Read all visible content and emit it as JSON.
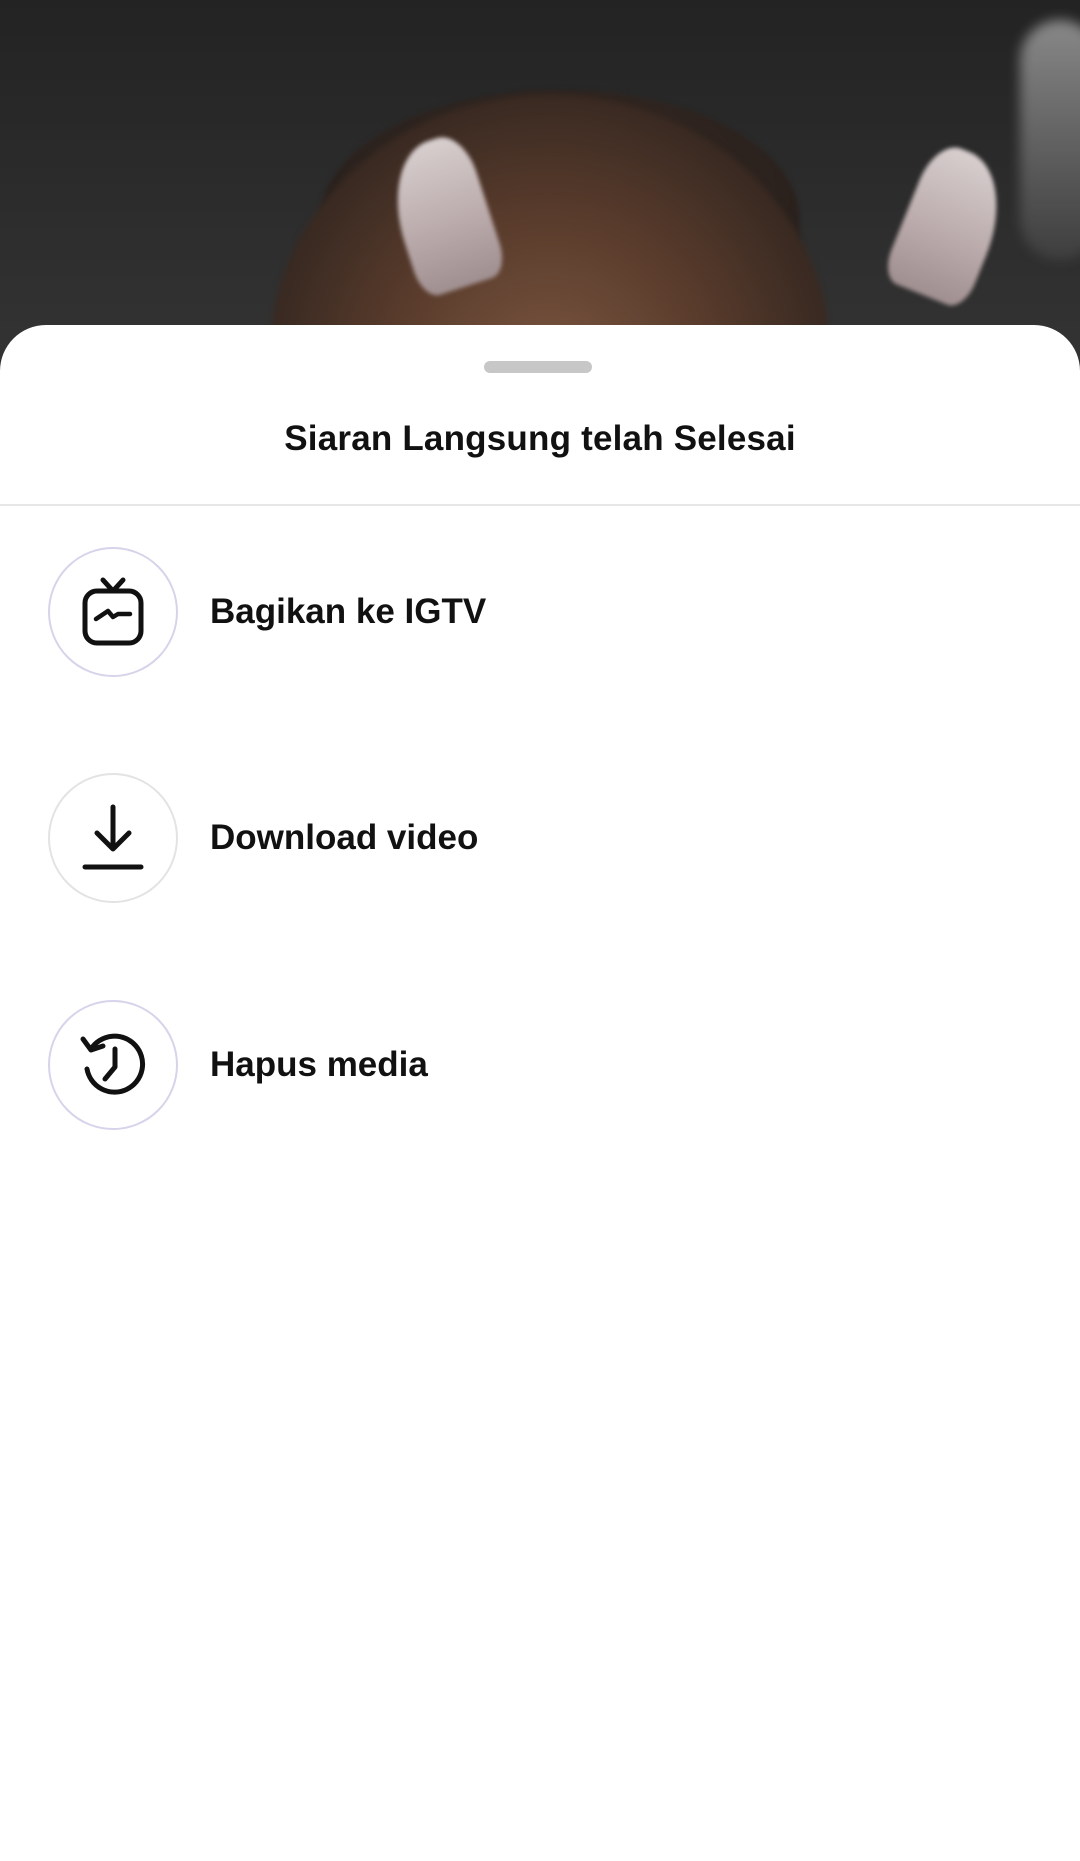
{
  "sheet": {
    "title": "Siaran Langsung telah Selesai"
  },
  "options": [
    {
      "label": "Bagikan ke IGTV",
      "icon": "igtv-icon"
    },
    {
      "label": "Download video",
      "icon": "download-icon"
    },
    {
      "label": "Hapus media",
      "icon": "history-icon"
    }
  ],
  "colors": {
    "sheet_bg": "#ffffff",
    "text": "#111111",
    "icon_ring": "#d7d3ea",
    "handle": "#c7c7c7",
    "divider": "#e6e6e6"
  }
}
